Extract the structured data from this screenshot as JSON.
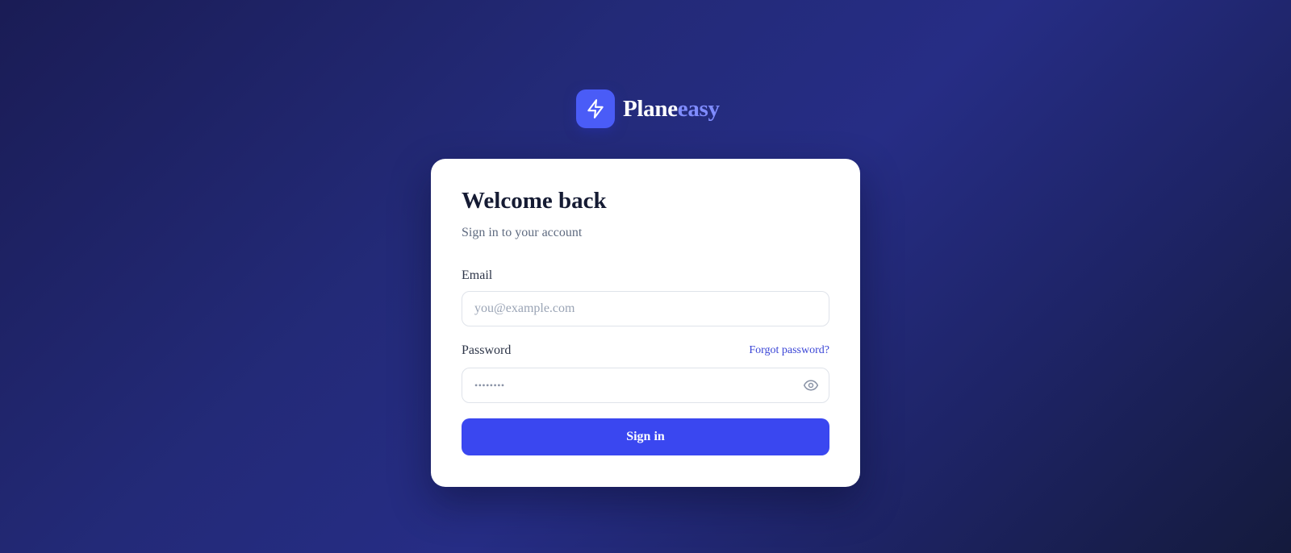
{
  "brand": {
    "name_part1": "Plane",
    "name_part2": "easy",
    "logo_icon": "lightning-bolt-icon",
    "logo_color": "#4a5cf7",
    "accent_color": "#7f8cff"
  },
  "card": {
    "title": "Welcome back",
    "subtitle": "Sign in to your account"
  },
  "form": {
    "email_label": "Email",
    "email_placeholder": "you@example.com",
    "email_value": "",
    "password_label": "Password",
    "password_masked": "••••••••",
    "forgot_link": "Forgot password?",
    "toggle_visibility_icon": "eye-icon",
    "submit_label": "Sign in",
    "submit_color": "#3a47f0",
    "link_color": "#3a45d6"
  }
}
